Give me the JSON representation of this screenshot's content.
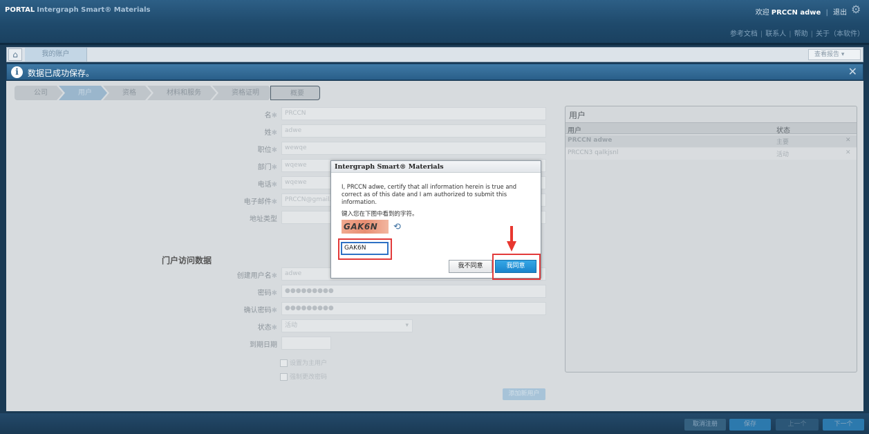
{
  "header": {
    "brand_prefix": "PORTAL",
    "brand_title": "Intergraph Smart® Materials",
    "welcome_prefix": "欢迎",
    "welcome_user": "PRCCN adwe",
    "logout": "退出",
    "links": [
      "参考文档",
      "联系人",
      "帮助",
      "关于（本软件）"
    ]
  },
  "appbar": {
    "account_tab": "我的账户",
    "report_button": "查看报告"
  },
  "message": {
    "text": "数据已成功保存。",
    "close": "✕"
  },
  "steps": [
    "公司",
    "用户",
    "资格",
    "材料和服务",
    "资格证明",
    "概要"
  ],
  "form": {
    "first_name": {
      "label": "名",
      "value": "PRCCN"
    },
    "last_name": {
      "label": "姓",
      "value": "adwe"
    },
    "position": {
      "label": "职位",
      "value": "wewqe"
    },
    "department": {
      "label": "部门",
      "value": "wqewe"
    },
    "phone": {
      "label": "电话",
      "value": "wqewe"
    },
    "email": {
      "label": "电子邮件",
      "value": "PRCCN@gmail.com"
    },
    "address_type": {
      "label": "地址类型",
      "value": ""
    },
    "section_title": "门户访问数据",
    "username": {
      "label": "创建用户名",
      "value": "adwe"
    },
    "password": {
      "label": "密码",
      "value": "●●●●●●●●●"
    },
    "confirm_password": {
      "label": "确认密码",
      "value": "●●●●●●●●●"
    },
    "status": {
      "label": "状态",
      "value": "活动"
    },
    "expiry": {
      "label": "到期日期",
      "value": ""
    },
    "check_main_user": "设置为主用户",
    "check_change_password": "强制更改密码",
    "add_user_button": "添加新用户"
  },
  "users_panel": {
    "title": "用户",
    "col_user": "用户",
    "col_status": "状态",
    "rows": [
      {
        "user": "PRCCN adwe",
        "status": "主要"
      },
      {
        "user": "PRCCN3 qalkjsnl",
        "status": "活动"
      }
    ]
  },
  "bottom": {
    "btn_cancel": "取消注册",
    "btn_save": "保存",
    "btn_prev": "上一个",
    "btn_next": "下一个"
  },
  "dialog": {
    "title": "Intergraph Smart® Materials",
    "certification": "I, PRCCN adwe, certify that all information herein is true and correct as of this date and I am authorized to submit this information.",
    "prompt": "键入您在下图中看到的字符。",
    "captcha_image_text": "GAK6N",
    "captcha_input": "GAK6N",
    "disagree": "我不同意",
    "agree": "我同意"
  }
}
